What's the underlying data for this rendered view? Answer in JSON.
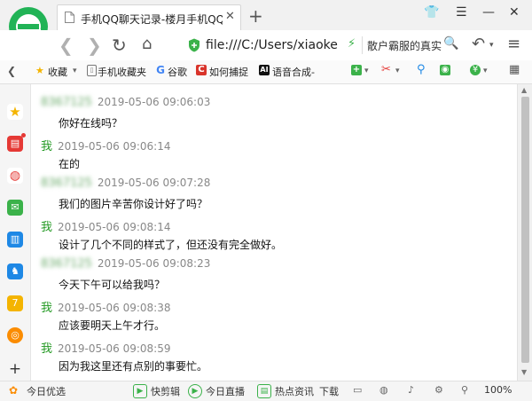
{
  "browser": {
    "tab": {
      "title": "手机QQ聊天记录-楼月手机QQ聊天记录导出恢复软件"
    },
    "address": {
      "url": "file:///C:/Users/xiaoke",
      "search_text": "散户霸服的真实身份"
    }
  },
  "bookmarks": [
    {
      "label": "收藏"
    },
    {
      "label": "手机收藏夹"
    },
    {
      "label": "谷歌"
    },
    {
      "label": "如何捕捉"
    },
    {
      "label": "语音合成-"
    }
  ],
  "chat": {
    "messages": [
      {
        "sender": "8367125",
        "is_me": false,
        "time": "2019-05-06 09:06:03",
        "text": "你好在线吗？"
      },
      {
        "sender": "我",
        "is_me": true,
        "time": "2019-05-06 09:06:14",
        "text": "在的"
      },
      {
        "sender": "8367125",
        "is_me": false,
        "time": "2019-05-06 09:07:28",
        "text": "我们的图片辛苦你设计好了吗？"
      },
      {
        "sender": "我",
        "is_me": true,
        "time": "2019-05-06 09:08:14",
        "text": "设计了几个不同的样式了，但还没有完全做好。"
      },
      {
        "sender": "8367125",
        "is_me": false,
        "time": "2019-05-06 09:08:23",
        "text": "今天下午可以给我吗？"
      },
      {
        "sender": "我",
        "is_me": true,
        "time": "2019-05-06 09:08:38",
        "text": "应该要明天上午才行。"
      },
      {
        "sender": "我",
        "is_me": true,
        "time": "2019-05-06 09:08:59",
        "text": "因为我这里还有点别的事要忙。"
      }
    ]
  },
  "statusbar": {
    "news": "今日优选",
    "clip": "快剪辑",
    "live": "今日直播",
    "hot": "热点资讯",
    "download": "下载",
    "zoom": "100%"
  },
  "colors": {
    "brand_green": "#21b356",
    "me_green": "#229922",
    "timestamp_gray": "#888888"
  }
}
